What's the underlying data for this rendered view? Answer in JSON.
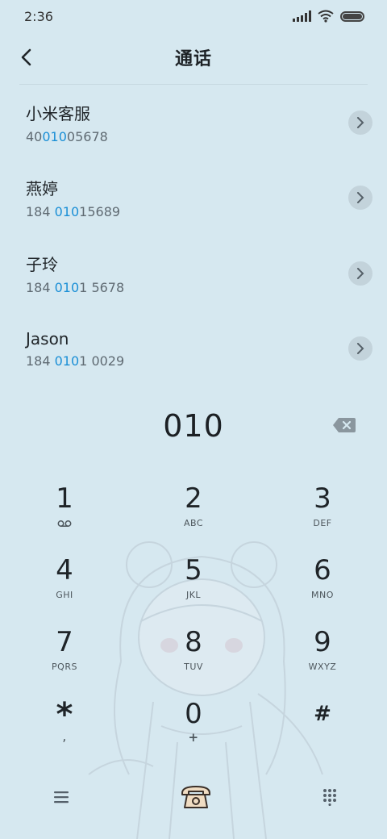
{
  "status_bar": {
    "time": "2:36"
  },
  "header": {
    "title": "通话"
  },
  "contacts": [
    {
      "name": "小米客服",
      "number_pre": "40",
      "number_match": "010",
      "number_post": "05678"
    },
    {
      "name": "燕婷",
      "number_pre": "184 ",
      "number_match": "010",
      "number_post": "15689"
    },
    {
      "name": "子玲",
      "number_pre": "184 ",
      "number_match": "010",
      "number_post": "1 5678"
    },
    {
      "name": "Jason",
      "number_pre": "184 ",
      "number_match": "010",
      "number_post": "1 0029"
    }
  ],
  "dial": {
    "number": "010"
  },
  "keypad": [
    {
      "digit": "1",
      "letters": ""
    },
    {
      "digit": "2",
      "letters": "ABC"
    },
    {
      "digit": "3",
      "letters": "DEF"
    },
    {
      "digit": "4",
      "letters": "GHI"
    },
    {
      "digit": "5",
      "letters": "JKL"
    },
    {
      "digit": "6",
      "letters": "MNO"
    },
    {
      "digit": "7",
      "letters": "PQRS"
    },
    {
      "digit": "8",
      "letters": "TUV"
    },
    {
      "digit": "9",
      "letters": "WXYZ"
    },
    {
      "digit": "*",
      "letters": ","
    },
    {
      "digit": "0",
      "letters": "+"
    },
    {
      "digit": "#",
      "letters": ""
    }
  ],
  "icons": {
    "back": "chevron-left-icon",
    "detail": "chevron-right-icon",
    "backspace": "backspace-icon",
    "voicemail": "voicemail-icon",
    "menu": "menu-icon",
    "call": "phone-icon",
    "keypad_toggle": "dialpad-icon"
  },
  "colors": {
    "background": "#d6e8f0",
    "highlight": "#1b8fd6",
    "call_button": "#f0dcc2"
  }
}
